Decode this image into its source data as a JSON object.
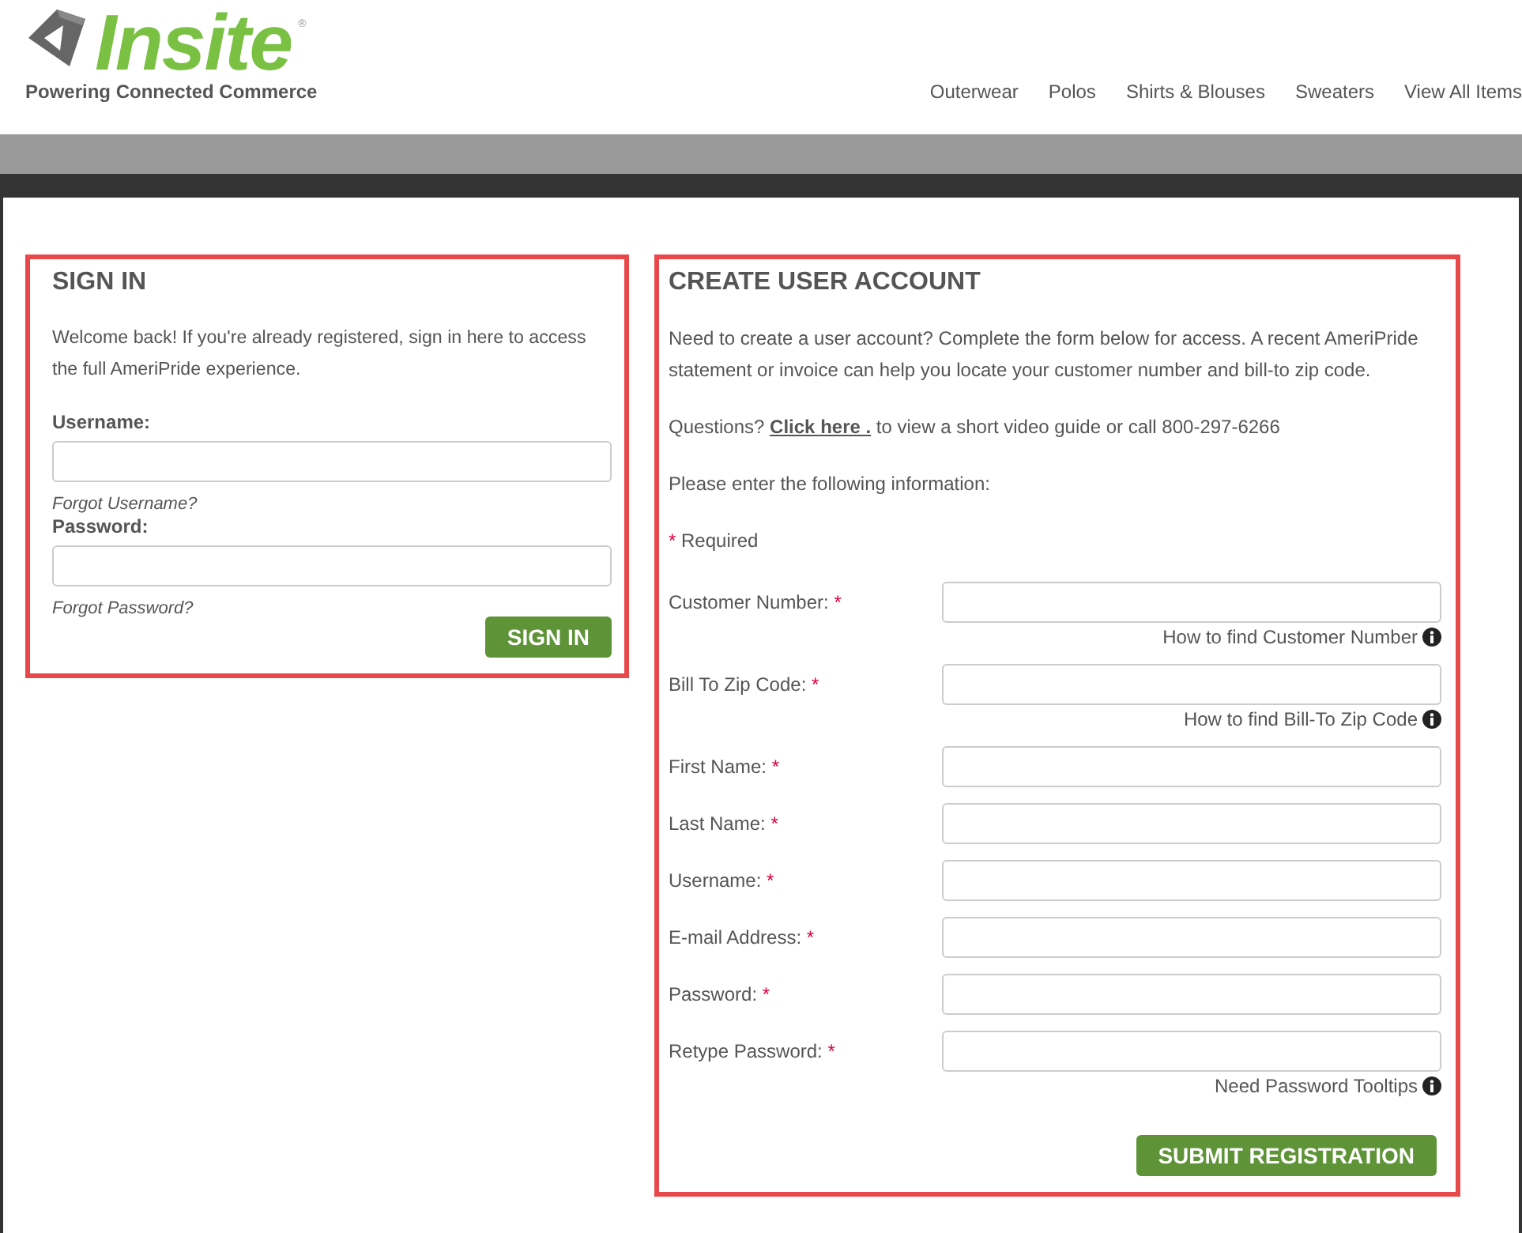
{
  "header": {
    "logo": {
      "name": "Insite",
      "mark": "®",
      "tagline": "Powering Connected Commerce"
    },
    "nav": [
      "Outerwear",
      "Polos",
      "Shirts & Blouses",
      "Sweaters",
      "View All Items"
    ]
  },
  "sign_in": {
    "title": "SIGN IN",
    "intro": "Welcome back! If you're already registered, sign in here to access the full AmeriPride experience.",
    "fields": [
      {
        "label": "Username:",
        "link": "Forgot Username?"
      },
      {
        "label": "Password:",
        "link": "Forgot Password?"
      }
    ],
    "button": "SIGN IN"
  },
  "create_account": {
    "title": "CREATE USER ACCOUNT",
    "intro": "Need to create a user account? Complete the form below for access. A recent AmeriPride statement or invoice can help you locate your customer number and bill-to zip code.",
    "questions": {
      "prefix": "Questions?",
      "link": "Click here .",
      "suffix": "to view a short video guide or call 800-297-6266"
    },
    "instruction": "Please enter the following information:",
    "required_note": {
      "mark": "*",
      "text": "Required"
    },
    "fields": [
      {
        "label": "Customer Number:",
        "required_mark": "*",
        "help": "How to find Customer Number"
      },
      {
        "label": "Bill To Zip Code:",
        "required_mark": "*",
        "help": "How to find Bill-To Zip Code"
      },
      {
        "label": "First Name:",
        "required_mark": "*"
      },
      {
        "label": "Last Name:",
        "required_mark": "*"
      },
      {
        "label": "Username:",
        "required_mark": "*"
      },
      {
        "label": "E-mail Address:",
        "required_mark": "*"
      },
      {
        "label": "Password:",
        "required_mark": "*"
      },
      {
        "label": "Retype Password:",
        "required_mark": "*",
        "help": "Need Password Tooltips"
      }
    ],
    "button": "SUBMIT REGISTRATION"
  }
}
